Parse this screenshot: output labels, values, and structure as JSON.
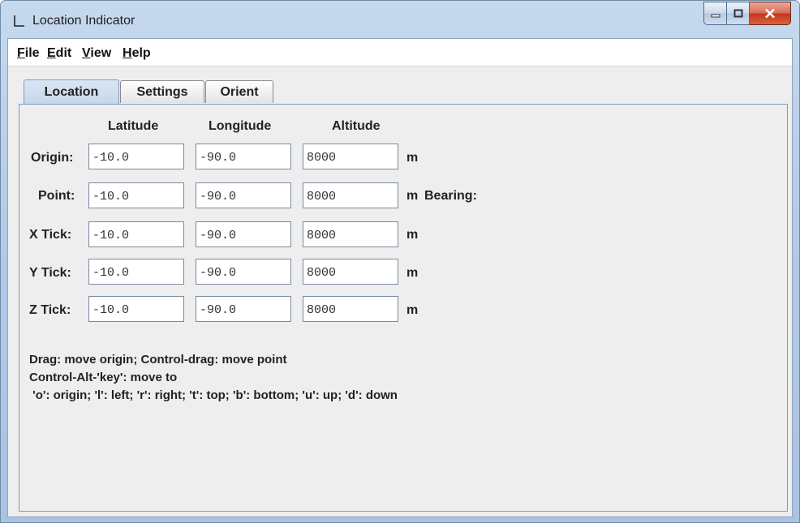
{
  "window": {
    "title": "Location Indicator",
    "icon": "axis-icon"
  },
  "menu": {
    "file": "File",
    "edit": "Edit",
    "view": "View",
    "help": "Help"
  },
  "tabs": [
    "Location",
    "Settings",
    "Orient"
  ],
  "active_tab": "Location",
  "columns": {
    "latitude": "Latitude",
    "longitude": "Longitude",
    "altitude": "Altitude"
  },
  "rows": [
    {
      "label": "Origin:",
      "lat": "-10.0",
      "lon": "-90.0",
      "alt": "8000",
      "unit": "m"
    },
    {
      "label": "Point:",
      "lat": "-10.0",
      "lon": "-90.0",
      "alt": "8000",
      "unit": "m",
      "extra": "Bearing:"
    },
    {
      "label": "X Tick:",
      "lat": "-10.0",
      "lon": "-90.0",
      "alt": "8000",
      "unit": "m"
    },
    {
      "label": "Y Tick:",
      "lat": "-10.0",
      "lon": "-90.0",
      "alt": "8000",
      "unit": "m"
    },
    {
      "label": "Z Tick:",
      "lat": "-10.0",
      "lon": "-90.0",
      "alt": "8000",
      "unit": "m"
    }
  ],
  "instructions": [
    "Drag: move origin; Control-drag: move point",
    "Control-Alt-'key': move to",
    " 'o': origin; 'l': left; 'r': right; 't': top; 'b': bottom; 'u': up; 'd': down"
  ]
}
